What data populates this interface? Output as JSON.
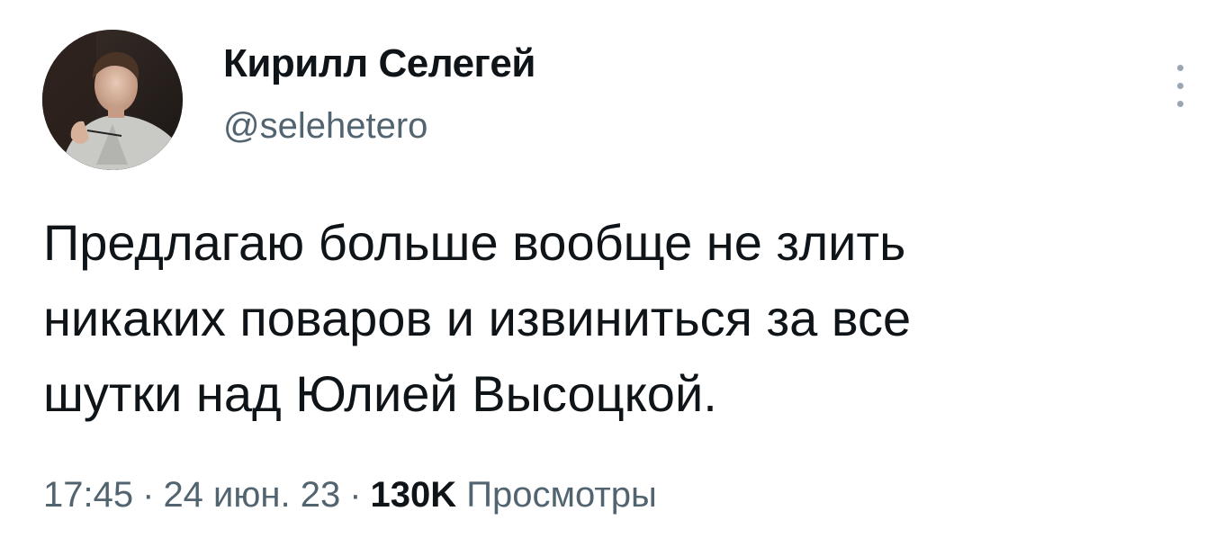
{
  "author": {
    "display_name": "Кирилл Селегей",
    "handle": "@selehetero"
  },
  "tweet": {
    "text": "Предлагаю больше вообще не злить\nникаких поваров и извиниться за все\nшутки над Юлией Высоцкой."
  },
  "meta": {
    "time": "17:45",
    "separator": "·",
    "date": "24 июн. 23",
    "views_count": "130K",
    "views_label": "Просмотры"
  },
  "icons": {
    "more": "more-vertical-icon"
  },
  "colors": {
    "text_primary": "#0f1419",
    "text_secondary": "#536471",
    "more_dots": "#9aa6b1",
    "background": "#ffffff"
  }
}
